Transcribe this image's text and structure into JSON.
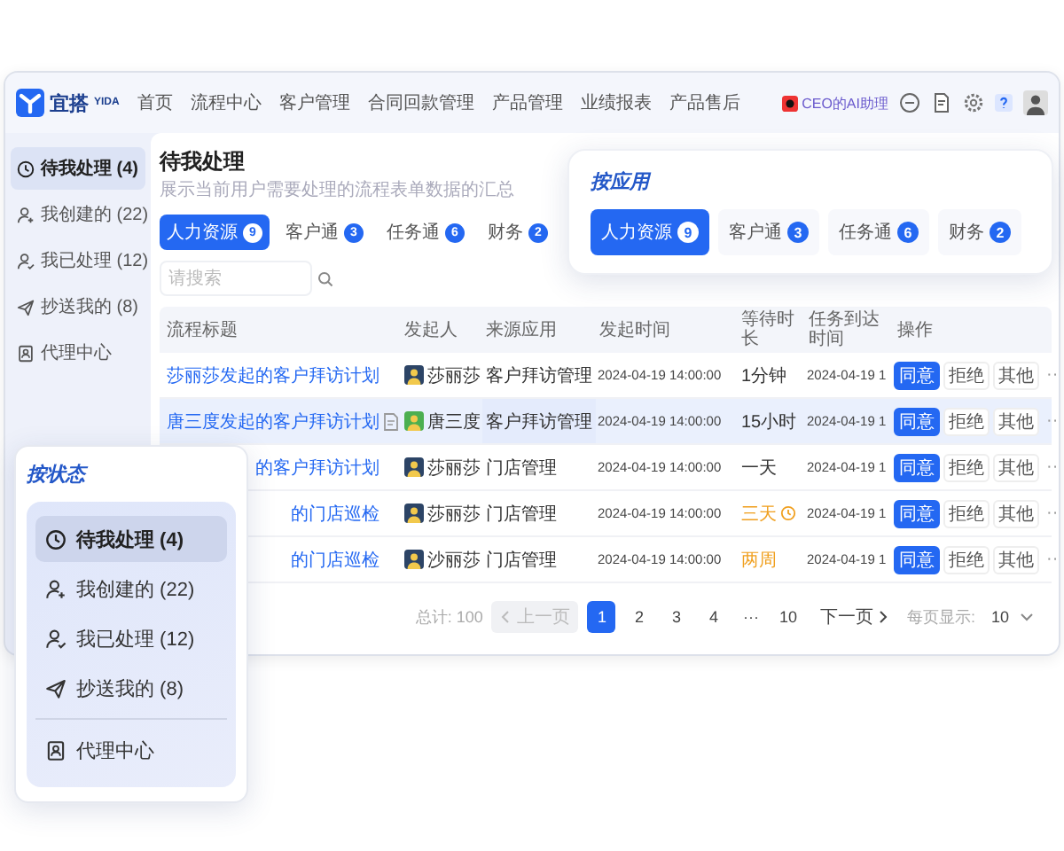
{
  "nav": {
    "logo": "宜搭",
    "logo_sub": "YIDA",
    "items": [
      "首页",
      "流程中心",
      "客户管理",
      "合同回款管理",
      "产品管理",
      "业绩报表",
      "产品售后"
    ],
    "assistant": "CEO的AI助理"
  },
  "sidebar": {
    "items": [
      {
        "label": "待我处理 (4)",
        "selected": true
      },
      {
        "label": "我创建的 (22)",
        "selected": false
      },
      {
        "label": "我已处理 (12)",
        "selected": false
      },
      {
        "label": "抄送我的 (8)",
        "selected": false
      },
      {
        "label": "代理中心",
        "selected": false
      }
    ]
  },
  "page": {
    "title": "待我处理",
    "subtitle": "展示当前用户需要处理的流程表单数据的汇总"
  },
  "app_tabs": [
    {
      "label": "人力资源",
      "count": "9",
      "selected": true
    },
    {
      "label": "客户通",
      "count": "3",
      "selected": false
    },
    {
      "label": "任务通",
      "count": "6",
      "selected": false
    },
    {
      "label": "财务",
      "count": "2",
      "selected": false
    }
  ],
  "search": {
    "placeholder": "请搜索"
  },
  "table": {
    "columns": [
      "流程标题",
      "发起人",
      "来源应用",
      "发起时间",
      "等待时长",
      "任务到达时间",
      "操作"
    ],
    "rows": [
      {
        "title": "莎丽莎发起的客户拜访计划",
        "attachment": false,
        "initiator": "莎丽莎",
        "color": "#2c4466",
        "app": "客户拜访管理",
        "started": "2024-04-19 14:00:00",
        "wait": "1分钟",
        "overdue": false,
        "alert": false,
        "arrived": "2024-04-19 1",
        "selected": false,
        "actions": [
          "同意",
          "拒绝",
          "其他",
          "···"
        ]
      },
      {
        "title": "唐三度发起的客户拜访计划",
        "attachment": true,
        "initiator": "唐三度",
        "color": "#4caf50",
        "app": "客户拜访管理",
        "started": "2024-04-19 14:00:00",
        "wait": "15小时",
        "overdue": false,
        "alert": false,
        "arrived": "2024-04-19 1",
        "selected": true,
        "actions": [
          "同意",
          "拒绝",
          "其他",
          "···"
        ]
      },
      {
        "title": "的客户拜访计划",
        "attachment": false,
        "initiator": "莎丽莎",
        "color": "#2c4466",
        "app": "门店管理",
        "started": "2024-04-19 14:00:00",
        "wait": "一天",
        "overdue": false,
        "alert": false,
        "arrived": "2024-04-19 1",
        "selected": false,
        "actions": [
          "同意",
          "拒绝",
          "其他",
          "···"
        ]
      },
      {
        "title": "的门店巡检",
        "attachment": false,
        "initiator": "莎丽莎",
        "color": "#2c4466",
        "app": "门店管理",
        "started": "2024-04-19 14:00:00",
        "wait": "三天",
        "overdue": true,
        "alert": true,
        "arrived": "2024-04-19 1",
        "selected": false,
        "actions": [
          "同意",
          "拒绝",
          "其他",
          "···"
        ]
      },
      {
        "title": "的门店巡检",
        "attachment": false,
        "initiator": "沙丽莎",
        "color": "#2c4466",
        "app": "门店管理",
        "started": "2024-04-19 14:00:00",
        "wait": "两周",
        "overdue": true,
        "alert": false,
        "arrived": "2024-04-19 1",
        "selected": false,
        "actions": [
          "同意",
          "拒绝",
          "其他",
          "···"
        ]
      }
    ]
  },
  "pagination": {
    "total": "总计: 100",
    "prev": {
      "label": "上一页",
      "disabled": true
    },
    "pages": [
      {
        "label": "1",
        "selected": true
      },
      {
        "label": "2",
        "selected": false
      },
      {
        "label": "3",
        "selected": false
      },
      {
        "label": "4",
        "selected": false
      },
      {
        "label": "···",
        "selected": false
      },
      {
        "label": "10",
        "selected": false
      }
    ],
    "next": {
      "label": "下一页",
      "disabled": false
    },
    "page_size_label": "每页显示:",
    "page_size": "10"
  },
  "app_popout": {
    "title": "按应用",
    "tabs": [
      {
        "label": "人力资源",
        "count": "9",
        "selected": true
      },
      {
        "label": "客户通",
        "count": "3",
        "selected": false
      },
      {
        "label": "任务通",
        "count": "6",
        "selected": false
      },
      {
        "label": "财务",
        "count": "2",
        "selected": false
      }
    ]
  },
  "status_popout": {
    "title": "按状态",
    "items": [
      {
        "label": "待我处理 (4)",
        "selected": true,
        "divider_above": false
      },
      {
        "label": "我创建的 (22)",
        "selected": false,
        "divider_above": false
      },
      {
        "label": "我已处理 (12)",
        "selected": false,
        "divider_above": false
      },
      {
        "label": "抄送我的 (8)",
        "selected": false,
        "divider_above": false
      },
      {
        "label": "代理中心",
        "selected": false,
        "divider_above": true
      }
    ]
  }
}
